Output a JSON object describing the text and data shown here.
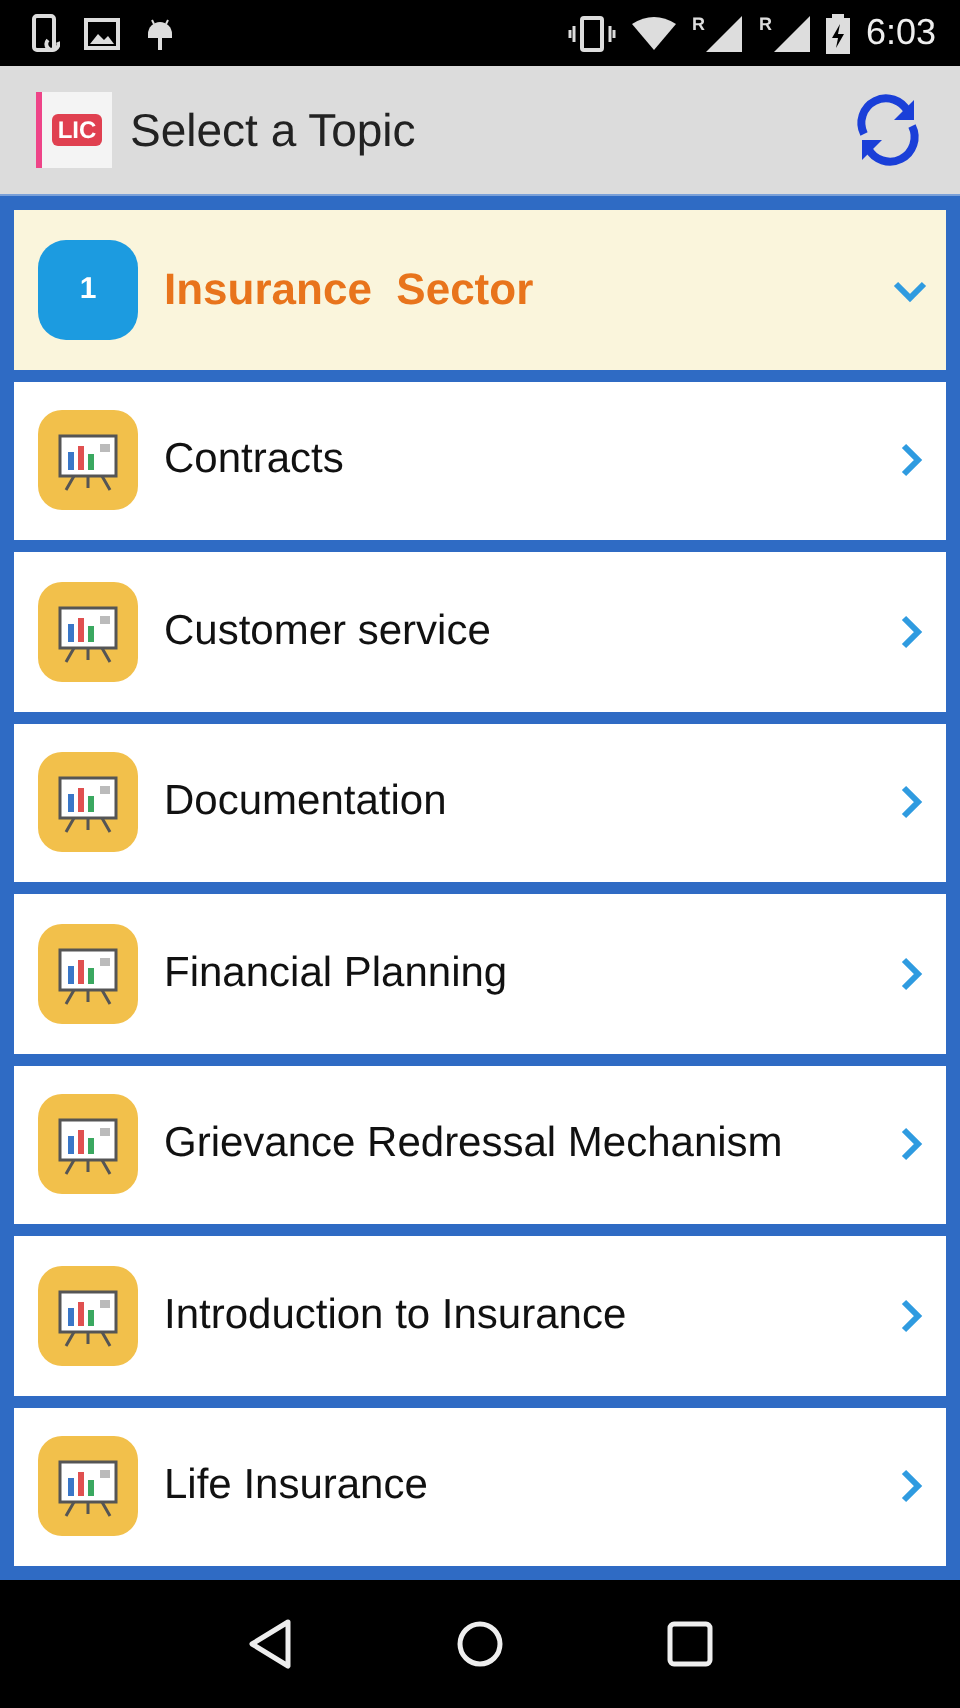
{
  "status_bar": {
    "time": "6:03",
    "signals": [
      {
        "roaming": "R"
      },
      {
        "roaming": "R"
      }
    ]
  },
  "app_bar": {
    "logo_text": "LIC",
    "title": "Select a Topic"
  },
  "topics": [
    {
      "kind": "header",
      "number": "1",
      "label": "Insurance  Sector",
      "expanded": true
    },
    {
      "kind": "topic",
      "label": "Contracts"
    },
    {
      "kind": "topic",
      "label": "Customer service"
    },
    {
      "kind": "topic",
      "label": "Documentation"
    },
    {
      "kind": "topic",
      "label": "Financial Planning"
    },
    {
      "kind": "topic",
      "label": "Grievance Redressal Mechanism"
    },
    {
      "kind": "topic",
      "label": "Introduction to Insurance"
    },
    {
      "kind": "topic",
      "label": "Life Insurance"
    }
  ]
}
